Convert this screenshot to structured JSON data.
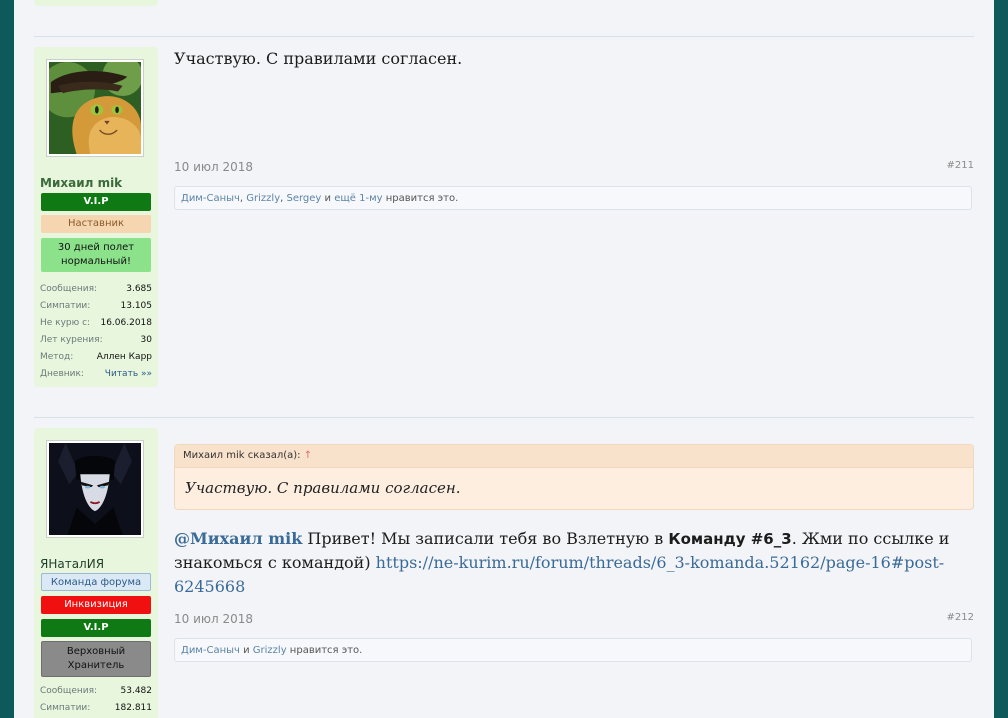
{
  "post1": {
    "user": {
      "name": "Михаил mik",
      "avatar_icon": "cat-avatar-icon",
      "banners": [
        "V.I.P",
        "Наставник",
        "30 дней полет нормальный!"
      ],
      "stats": [
        {
          "key": "Сообщения:",
          "value": "3.685"
        },
        {
          "key": "Симпатии:",
          "value": "13.105"
        },
        {
          "key": "Не курю с:",
          "value": "16.06.2018"
        },
        {
          "key": "Лет курения:",
          "value": "30"
        },
        {
          "key": "Метод:",
          "value": "Аллен Карр"
        },
        {
          "key": "Дневник:",
          "value": "Читать »»"
        }
      ]
    },
    "text": "Участвую. С правилами согласен.",
    "date": "10 июл 2018",
    "number": "#211",
    "likes": {
      "names": [
        "Дим-Саныч",
        "Grizzly",
        "Sergey"
      ],
      "more": "ещё 1-му",
      "sep1": ", ",
      "sep2": ", ",
      "and": " и ",
      "suffix": " нравится это."
    }
  },
  "post2": {
    "user": {
      "name": "ЯНаталИЯ",
      "avatar_icon": "woman-avatar-icon",
      "banners": [
        "Команда форума",
        "Инквизиция",
        "V.I.P",
        "Верховный Хранитель"
      ],
      "stats": [
        {
          "key": "Сообщения:",
          "value": "53.482"
        },
        {
          "key": "Симпатии:",
          "value": "182.811"
        }
      ]
    },
    "quote": {
      "author": "Михаил mik сказал(а):",
      "arrow": "↑",
      "text": "Участвую. С правилами согласен."
    },
    "message": {
      "mention": "@Михаил mik",
      "part1": " Привет! Мы записали тебя во Взлетную в ",
      "team": "Команду #6_3",
      "part2": ". Жми по ссылке и знакомься с командой) ",
      "link": "https://ne-kurim.ru/forum/threads/6_3-komanda.52162/page-16#post-6245668"
    },
    "date": "10 июл 2018",
    "number": "#212",
    "likes": {
      "names": [
        "Дим-Саныч",
        "Grizzly"
      ],
      "and": " и ",
      "suffix": " нравится это."
    }
  },
  "colors": {
    "outer_background": "#0e5a5a",
    "page_background": "#f3f4f8",
    "user_column": "#e8f6dd",
    "vip": "#0f7a14",
    "inquisition": "#f11010",
    "link": "#3a6a97"
  }
}
